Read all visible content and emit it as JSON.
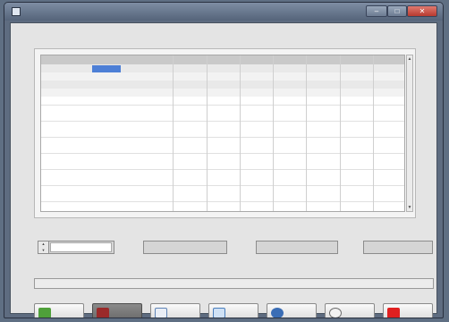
{
  "window": {
    "title": "",
    "icon": "app-icon"
  },
  "controls": {
    "minimize_icon": "minimize-icon",
    "maximize_icon": "maximize-icon",
    "close_icon": "close-x-icon"
  },
  "table": {
    "title": "",
    "selected_row": 0
  },
  "fields": {
    "target_duration": {
      "label": "",
      "value": ""
    },
    "high_voltage": {
      "label": "",
      "value": ""
    },
    "measured_amplitude": {
      "label": "",
      "value": ""
    },
    "measured_current": {
      "label": "",
      "value": ""
    }
  },
  "progress": {
    "label": "",
    "value": "",
    "fraction": 0
  },
  "buttons": {
    "start": {
      "label": "",
      "icon": "play-icon"
    },
    "reset": {
      "label": "",
      "icon": "reset-icon"
    },
    "edit": {
      "label": "",
      "icon": "edit-icon"
    },
    "load": {
      "label": "",
      "icon": "load-icon"
    },
    "help": {
      "label": "",
      "icon": "help-icon"
    },
    "info": {
      "label": "",
      "icon": "info-icon"
    },
    "exit": {
      "label": "",
      "icon": "stop-icon"
    }
  },
  "colors": {
    "frame": "#5e6c80",
    "panel": "#e4e4e4",
    "selection": "#4d7fd6",
    "start_icon": "#4fa03a",
    "exit_icon": "#e02020"
  }
}
